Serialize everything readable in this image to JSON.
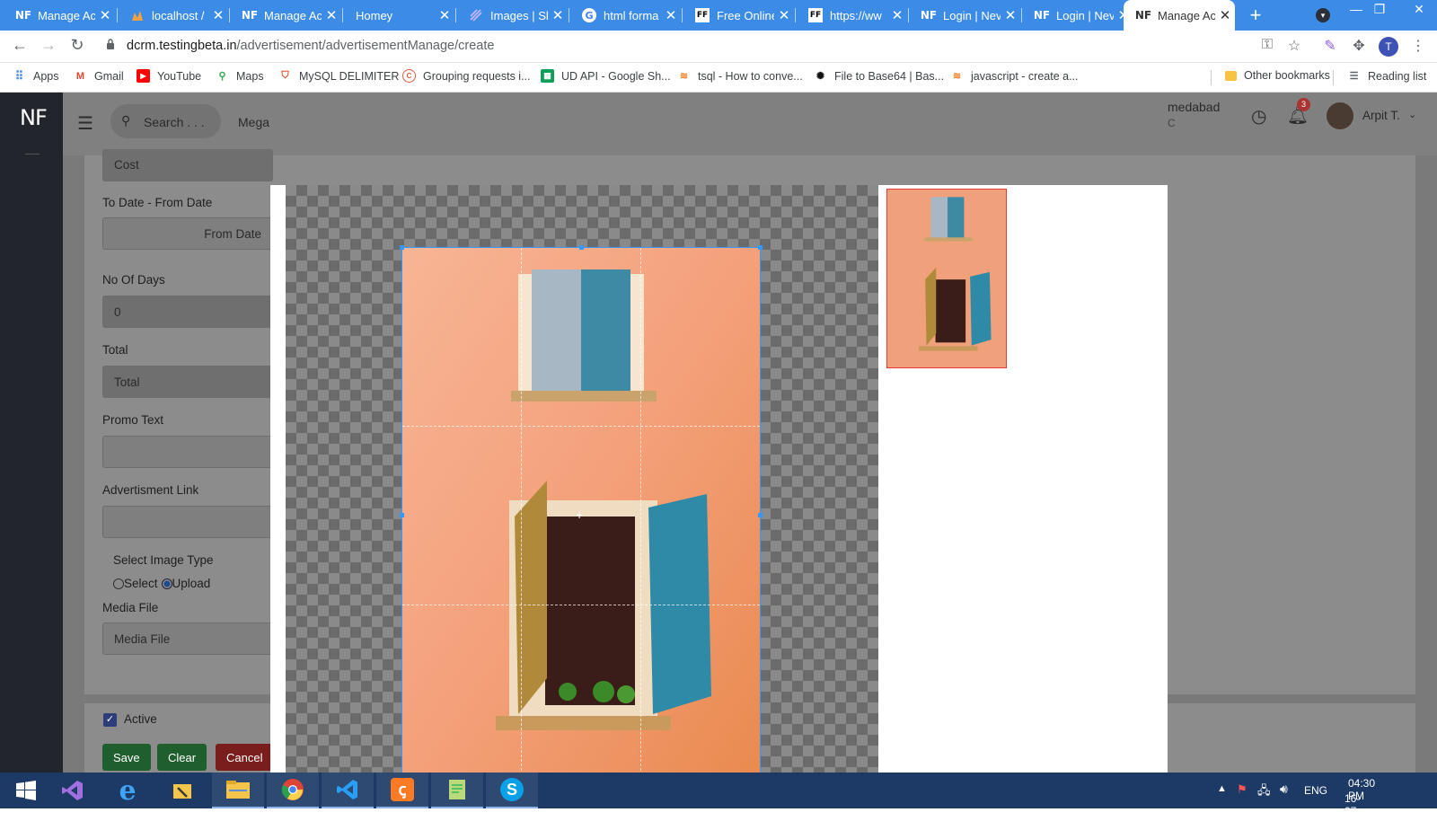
{
  "browser": {
    "tabs": [
      {
        "favicon": "NF",
        "title": "Manage Ac"
      },
      {
        "favicon": "localhost-icon",
        "title": "localhost /"
      },
      {
        "favicon": "NF",
        "title": "Manage Ac"
      },
      {
        "favicon": "",
        "title": "Homey"
      },
      {
        "favicon": "images-icon",
        "title": "Images | Sh"
      },
      {
        "favicon": "google-icon",
        "title": "html forma"
      },
      {
        "favicon": "FF",
        "title": "Free Online"
      },
      {
        "favicon": "FF",
        "title": "https://ww"
      },
      {
        "favicon": "NF",
        "title": "Login | Nev"
      },
      {
        "favicon": "NF",
        "title": "Login | Nev"
      },
      {
        "favicon": "NF",
        "title": "Manage Ac",
        "active": true
      }
    ],
    "new_tab": "+",
    "url_host": "dcrm.testingbeta.in",
    "url_path": "/advertisement/advertisementManage/create",
    "profile_initial": "T",
    "bookmarks": [
      {
        "icon": "apps-grid-icon",
        "label": "Apps"
      },
      {
        "icon": "gmail-icon",
        "label": "Gmail"
      },
      {
        "icon": "youtube-icon",
        "label": "YouTube"
      },
      {
        "icon": "maps-icon",
        "label": "Maps"
      },
      {
        "icon": "mysql-icon",
        "label": "MySQL DELIMITER"
      },
      {
        "icon": "grouping-icon",
        "label": "Grouping requests i..."
      },
      {
        "icon": "sheets-icon",
        "label": "UD API - Google Sh..."
      },
      {
        "icon": "stackoverflow-icon",
        "label": "tsql - How to conve..."
      },
      {
        "icon": "base64-icon",
        "label": "File to Base64 | Bas..."
      },
      {
        "icon": "stackoverflow-icon",
        "label": "javascript - create a..."
      }
    ],
    "other_bookmarks": "Other bookmarks",
    "reading_list": "Reading list"
  },
  "app": {
    "logo": "NF",
    "search_placeholder": "Search . . .",
    "menu_partial": "Mega",
    "location": "medabad",
    "location_sub": "C",
    "notification_count": "3",
    "user_name": "Arpit T."
  },
  "form": {
    "cost_placeholder": "Cost",
    "date_label": "To Date - From Date",
    "from_date_placeholder": "From Date",
    "days_label": "No Of Days",
    "days_value": "0",
    "total_label": "Total",
    "total_placeholder": "Total",
    "promo_label": "Promo Text",
    "link_label": "Advertisment Link",
    "image_type_label": "Select Image Type",
    "radio_select": "Select",
    "radio_upload": "Upload",
    "media_label": "Media File",
    "media_placeholder": "Media File",
    "active_label": "Active",
    "buttons": [
      "Save",
      "Clear",
      "Cancel"
    ]
  },
  "taskbar": {
    "apps": [
      "start-icon",
      "visual-studio-icon",
      "internet-explorer-icon",
      "file-tools-icon",
      "file-explorer-icon",
      "chrome-icon",
      "vscode-icon",
      "xampp-icon",
      "notepad-icon",
      "skype-icon"
    ],
    "language": "ENG",
    "time": "04:30 PM",
    "date": "16-07-2021"
  }
}
